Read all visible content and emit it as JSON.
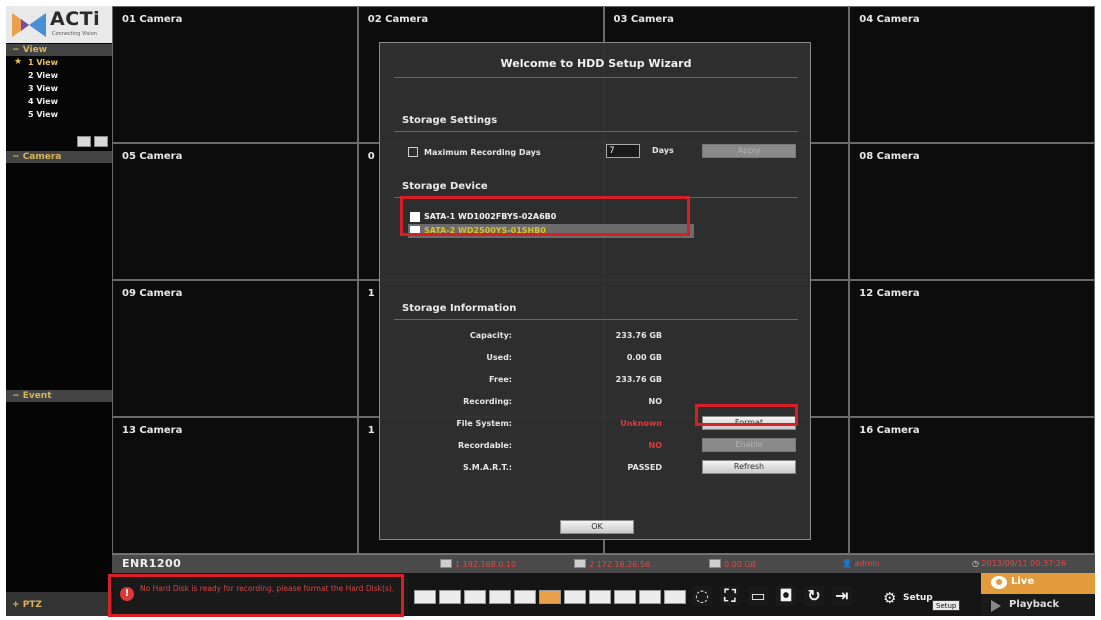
{
  "brand": {
    "name": "ACTi",
    "tagline": "Connecting Vision"
  },
  "sidebar": {
    "view_header": "View",
    "views": [
      "1 View",
      "2 View",
      "3 View",
      "4 View",
      "5 View"
    ],
    "camera_header": "Camera",
    "event_header": "Event",
    "ptz_header": "PTZ"
  },
  "grid": {
    "cameras": [
      "01 Camera",
      "02 Camera",
      "03 Camera",
      "04 Camera",
      "05 Camera",
      "0",
      "",
      "08 Camera",
      "09 Camera",
      "1",
      "",
      "12 Camera",
      "13 Camera",
      "1",
      "",
      "16 Camera"
    ]
  },
  "status": {
    "model": "ENR1200",
    "ip1": "1 192.168.0.10",
    "ip2": "2 172.16.26.56",
    "storage": "0.00 GB",
    "user": "admin",
    "datetime": "2013/09/11 00:37:26"
  },
  "toolbar": {
    "message": "No Hard Disk is ready for recording, please format the Hard Disk(s).",
    "setup_label": "Setup",
    "setup_tooltip": "Setup",
    "live_label": "Live",
    "playback_label": "Playback"
  },
  "wizard": {
    "title": "Welcome to  HDD Setup Wizard",
    "storage_settings": {
      "heading": "Storage Settings",
      "max_days_label": "Maximum Recording Days",
      "days_value": "7",
      "days_unit": "Days",
      "apply_label": "Apply"
    },
    "storage_device": {
      "heading": "Storage Device",
      "devices": [
        "SATA-1  WD1002FBYS-02A6B0",
        "SATA-2  WD2500YS-01SHB0"
      ]
    },
    "storage_info": {
      "heading": "Storage Information",
      "rows": [
        {
          "label": "Capacity:",
          "value": "233.76 GB"
        },
        {
          "label": "Used:",
          "value": "0.00 GB"
        },
        {
          "label": "Free:",
          "value": "233.76 GB"
        },
        {
          "label": "Recording:",
          "value": "NO"
        },
        {
          "label": "File System:",
          "value": "Unknown"
        },
        {
          "label": "Recordable:",
          "value": "NO"
        },
        {
          "label": "S.M.A.R.T.:",
          "value": "PASSED"
        }
      ],
      "format_label": "Format",
      "enable_label": "Enable",
      "refresh_label": "Refresh"
    },
    "ok_label": "OK"
  },
  "colors": {
    "accent": "#e29c3e",
    "highlight": "#d61f26",
    "warning_text": "#d64545"
  }
}
